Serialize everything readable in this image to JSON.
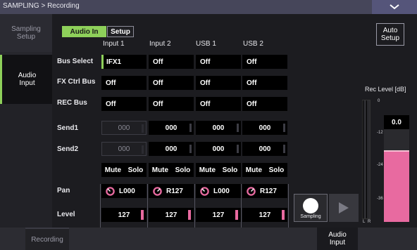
{
  "titlebar": {
    "title": "SAMPLING > Recording"
  },
  "sidebar": [
    {
      "label": "Sampling Setup"
    },
    {
      "label": "Audio Input"
    }
  ],
  "tabs": {
    "audio_in": "Audio In",
    "setup": "Setup"
  },
  "auto_setup": "Auto Setup",
  "columns": [
    "Input 1",
    "Input 2",
    "USB 1",
    "USB 2"
  ],
  "row_labels": {
    "bus_select": "Bus Select",
    "fx_ctrl_bus": "FX Ctrl Bus",
    "rec_bus": "REC Bus",
    "send1": "Send1",
    "send2": "Send2",
    "pan": "Pan",
    "level": "Level"
  },
  "bus_select": [
    "IFX1",
    "Off",
    "Off",
    "Off"
  ],
  "fx_ctrl_bus": [
    "Off",
    "Off",
    "Off",
    "Off"
  ],
  "rec_bus": [
    "Off",
    "Off",
    "Off",
    "Off"
  ],
  "send1": [
    "000",
    "000",
    "000",
    "000"
  ],
  "send2": [
    "000",
    "000",
    "000",
    "000"
  ],
  "mute_label": "Mute",
  "solo_label": "Solo",
  "pan": [
    "L000",
    "R127",
    "L000",
    "R127"
  ],
  "level": [
    "127",
    "127",
    "127",
    "127"
  ],
  "sampling_label": "Sampling",
  "rec_level": {
    "title": "Rec Level [dB]",
    "value": "0.0",
    "scale": [
      "0",
      "-12",
      "-24",
      "-36"
    ],
    "channels": [
      "L",
      "R"
    ]
  },
  "bottom_tabs": [
    "Recording",
    "Audio Input"
  ],
  "colors": {
    "accent": "#8ed05a",
    "level_bar": "#e86aa0"
  }
}
